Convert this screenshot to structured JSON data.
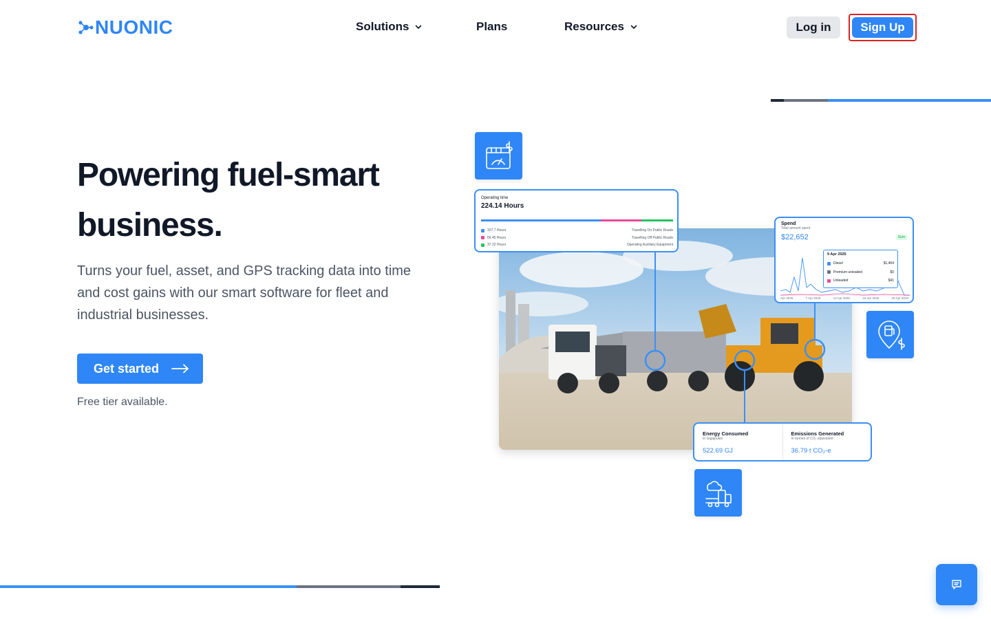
{
  "brand": {
    "name": "NUONIC",
    "color": "#2f86f6"
  },
  "nav": {
    "items": [
      {
        "label": "Solutions",
        "has_dropdown": true
      },
      {
        "label": "Plans",
        "has_dropdown": false
      },
      {
        "label": "Resources",
        "has_dropdown": true
      }
    ],
    "login_label": "Log in",
    "signup_label": "Sign Up"
  },
  "hero": {
    "title_line1": "Powering fuel-smart",
    "title_line2": "business.",
    "subtitle": "Turns your fuel, asset, and GPS tracking data into time and cost gains with our smart software for fleet and industrial businesses.",
    "cta_label": "Get started",
    "cta_icon": "arrow-right-icon",
    "free_note": "Free tier available."
  },
  "carousel": {
    "top_progress": [
      {
        "fraction": 0.06,
        "color": "#1f2937"
      },
      {
        "fraction": 0.2,
        "color": "#6b7280"
      },
      {
        "fraction": 0.74,
        "color": "#3b8ff5"
      }
    ],
    "bottom_progress": [
      {
        "fraction": 0.675,
        "color": "#3b8ff5"
      },
      {
        "fraction": 0.235,
        "color": "#6b7280"
      },
      {
        "fraction": 0.09,
        "color": "#1f2937"
      }
    ]
  },
  "illustration": {
    "icons": [
      "fuel-gauge-dollar-icon",
      "fuel-pump-dollar-icon",
      "truck-emissions-icon"
    ],
    "operating": {
      "title": "Operating time",
      "value": "224.14 Hours",
      "bar": [
        {
          "fraction": 0.625,
          "color": "#3b8ff5"
        },
        {
          "fraction": 0.21,
          "color": "#ec4899"
        },
        {
          "fraction": 0.165,
          "color": "#22c55e"
        }
      ],
      "rows": [
        {
          "hours": "157.7 Hours",
          "label": "Travelling On Public Roads",
          "color": "#3b8ff5"
        },
        {
          "hours": "66.45 Hours",
          "label": "Travelling Off Public Roads",
          "color": "#ec4899"
        },
        {
          "hours": "37.22 Hours",
          "label": "Operating Auxiliary Equipment",
          "color": "#22c55e"
        }
      ]
    },
    "spend": {
      "title": "Spend",
      "subtitle": "Total amount spent",
      "value": "$22,652",
      "badge": "Sum",
      "tooltip": {
        "date": "9 Apr 2025",
        "rows": [
          {
            "label": "Diesel",
            "value": "$1,464",
            "color": "#3b8ff5"
          },
          {
            "label": "Premium unleaded",
            "value": "$0",
            "color": "#6b7280"
          },
          {
            "label": "Unleaded",
            "value": "$41",
            "color": "#ec4899"
          }
        ]
      },
      "axis_labels": [
        "Apr 2025",
        "7 Apr 2025",
        "13 Apr 2025",
        "19 Apr 2025",
        "25 Apr 2025"
      ]
    },
    "energy": {
      "title": "Energy Consumed",
      "subtitle": "In Gigajoules",
      "value": "522.69 GJ"
    },
    "emissions": {
      "title": "Emissions Generated",
      "subtitle": "In tonnes of CO₂ equivalent",
      "value": "36.79 t CO₂-e"
    }
  },
  "chat": {
    "icon": "chat-icon"
  }
}
